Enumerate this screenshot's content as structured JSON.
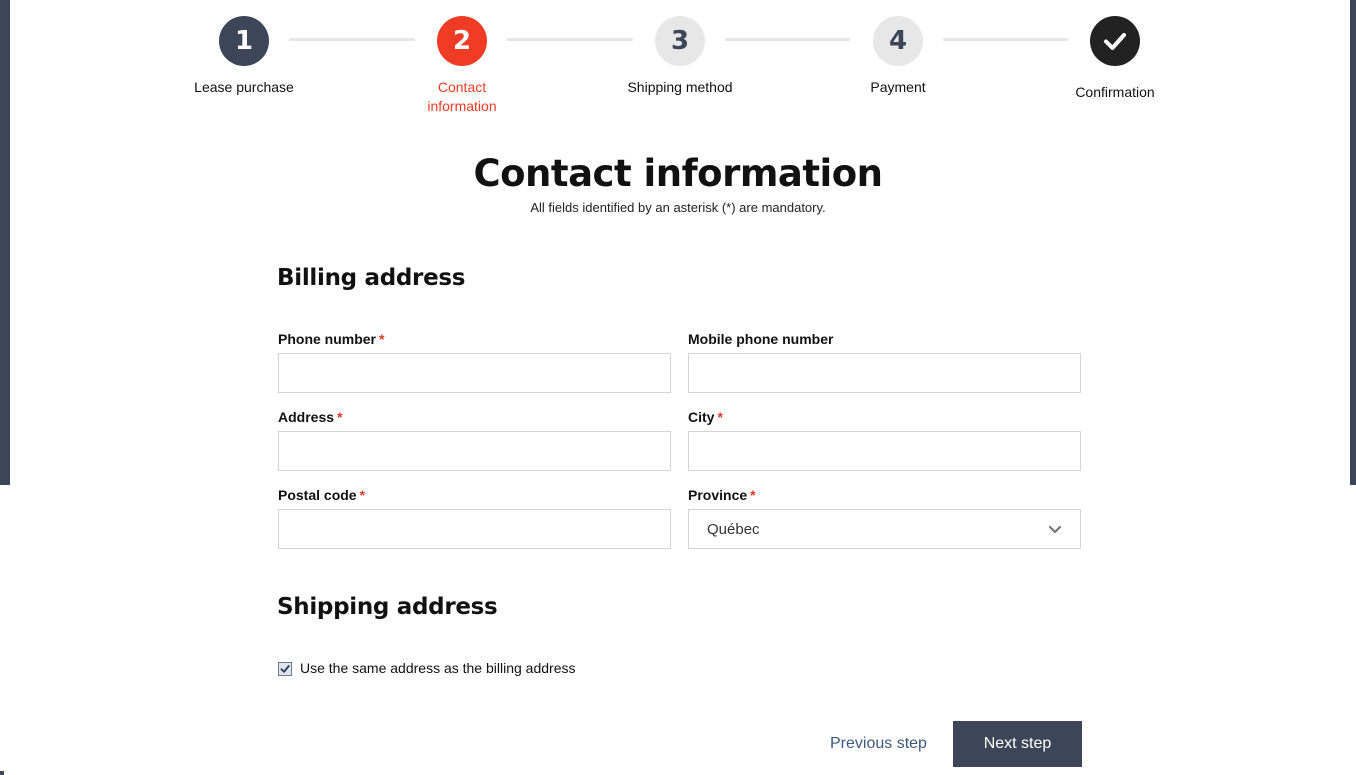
{
  "stepper": {
    "steps": [
      {
        "number": "1",
        "label": "Lease purchase",
        "state": "done"
      },
      {
        "number": "2",
        "label_line1": "Contact",
        "label_line2": "information",
        "state": "active"
      },
      {
        "number": "3",
        "label": "Shipping method",
        "state": "todo"
      },
      {
        "number": "4",
        "label": "Payment",
        "state": "todo"
      },
      {
        "icon": "checkmark-icon",
        "label": "Confirmation",
        "state": "final"
      }
    ]
  },
  "page": {
    "title": "Contact information",
    "subtitle": "All fields identified by an asterisk (*) are mandatory."
  },
  "billing": {
    "title": "Billing address",
    "required_marker": "*",
    "fields": {
      "phone": {
        "label": "Phone number",
        "value": ""
      },
      "mobile": {
        "label": "Mobile phone number",
        "value": ""
      },
      "address": {
        "label": "Address",
        "value": ""
      },
      "city": {
        "label": "City",
        "value": ""
      },
      "postal": {
        "label": "Postal code",
        "value": ""
      },
      "province": {
        "label": "Province",
        "value": "Québec"
      }
    }
  },
  "shipping": {
    "title": "Shipping address",
    "same_address_label": "Use the same address as the billing address",
    "same_address_checked": true
  },
  "actions": {
    "previous": "Previous step",
    "next": "Next step"
  },
  "colors": {
    "accent": "#f03c24",
    "primary": "#3c4658",
    "link": "#3d5a80"
  }
}
